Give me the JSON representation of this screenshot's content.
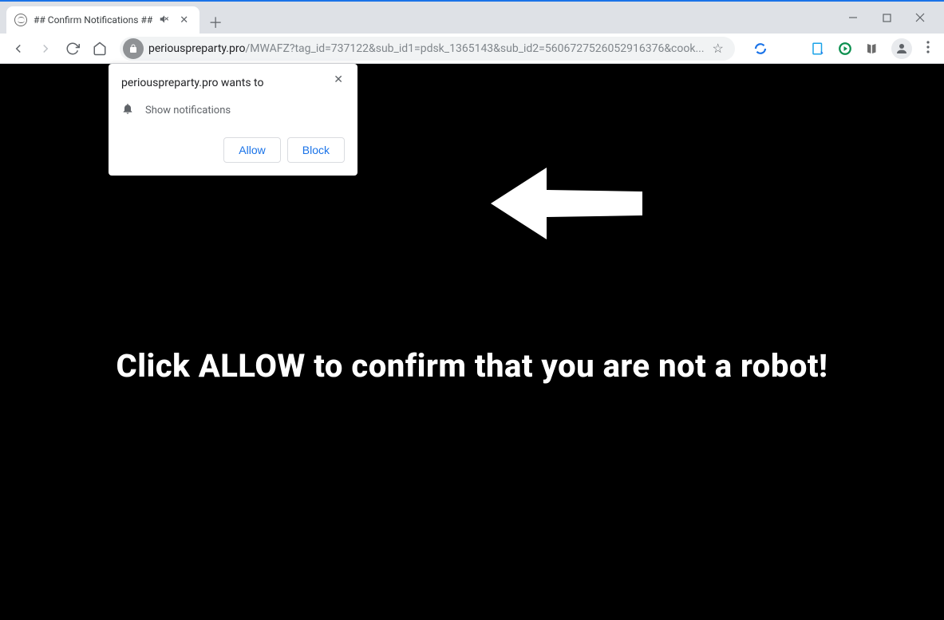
{
  "window": {
    "tab_title": "## Confirm Notifications ##"
  },
  "url": {
    "domain": "periouspreparty.pro",
    "path": "/MWAFZ?tag_id=737122&sub_id1=pdsk_1365143&sub_id2=5606727526052916376&cook..."
  },
  "permission": {
    "origin_label": "periouspreparty.pro wants to",
    "request_label": "Show notifications",
    "allow_label": "Allow",
    "block_label": "Block"
  },
  "page": {
    "headline": "Click ALLOW to confirm that you are not a robot!"
  }
}
